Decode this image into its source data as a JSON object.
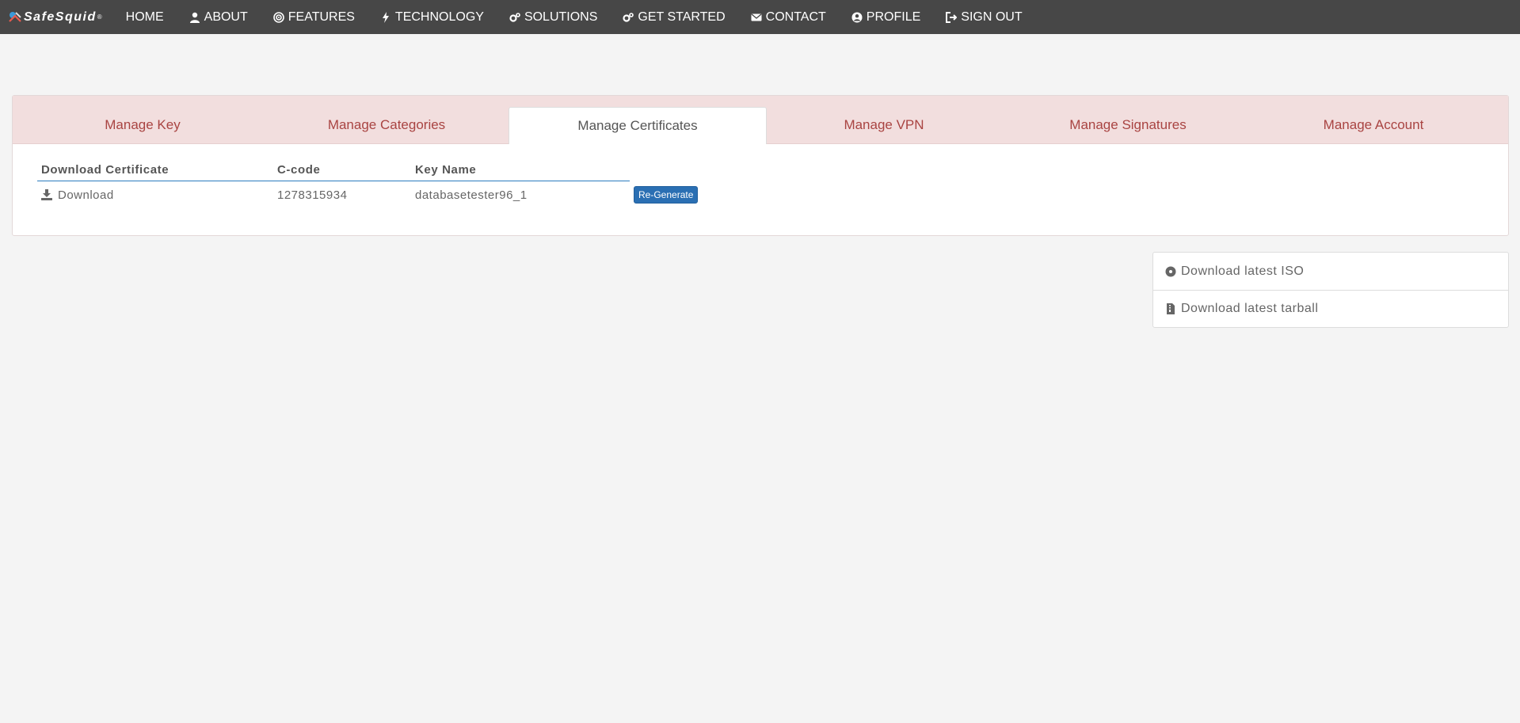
{
  "brand": {
    "name": "SafeSquid",
    "reg": "®"
  },
  "nav": [
    {
      "label": "HOME",
      "icon": "none"
    },
    {
      "label": "ABOUT",
      "icon": "user-icon"
    },
    {
      "label": "FEATURES",
      "icon": "target-icon"
    },
    {
      "label": "TECHNOLOGY",
      "icon": "bolt-icon"
    },
    {
      "label": "SOLUTIONS",
      "icon": "gears-icon"
    },
    {
      "label": "GET STARTED",
      "icon": "gears-icon"
    },
    {
      "label": "CONTACT",
      "icon": "envelope-icon"
    },
    {
      "label": "PROFILE",
      "icon": "user-circle-icon"
    },
    {
      "label": "SIGN OUT",
      "icon": "sign-out-icon"
    }
  ],
  "tabs": [
    {
      "label": "Manage Key"
    },
    {
      "label": "Manage Categories"
    },
    {
      "label": "Manage Certificates",
      "active": true
    },
    {
      "label": "Manage VPN"
    },
    {
      "label": "Manage Signatures"
    },
    {
      "label": "Manage Account"
    }
  ],
  "table": {
    "headers": [
      "Download Certificate",
      "C-code",
      "Key Name"
    ],
    "rows": [
      {
        "download": "Download",
        "ccode": "1278315934",
        "keyname": "databasetester96_1",
        "action": "Re-Generate"
      }
    ]
  },
  "downloads": [
    {
      "label": "Download latest ISO",
      "icon": "disc-icon"
    },
    {
      "label": "Download latest tarball",
      "icon": "file-archive-icon"
    }
  ],
  "colors": {
    "navbar": "#474747",
    "tabs_bg": "#f2dede",
    "tab_text": "#a94442",
    "accent": "#2a6fb3"
  }
}
